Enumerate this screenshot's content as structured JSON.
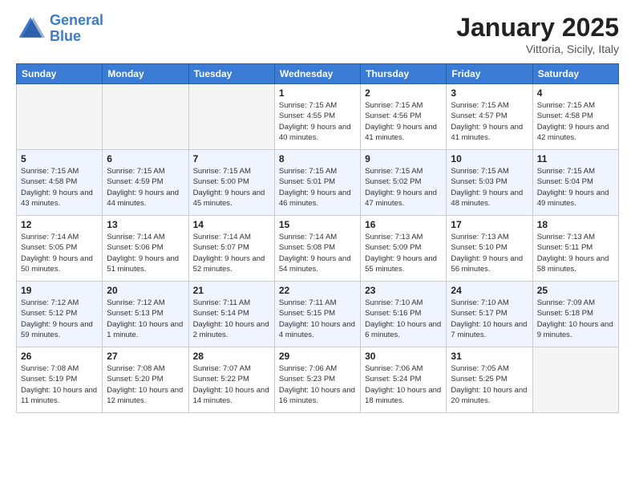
{
  "header": {
    "logo_line1": "General",
    "logo_line2": "Blue",
    "title": "January 2025",
    "subtitle": "Vittoria, Sicily, Italy"
  },
  "weekdays": [
    "Sunday",
    "Monday",
    "Tuesday",
    "Wednesday",
    "Thursday",
    "Friday",
    "Saturday"
  ],
  "weeks": [
    [
      {
        "day": "",
        "info": ""
      },
      {
        "day": "",
        "info": ""
      },
      {
        "day": "",
        "info": ""
      },
      {
        "day": "1",
        "info": "Sunrise: 7:15 AM\nSunset: 4:55 PM\nDaylight: 9 hours\nand 40 minutes."
      },
      {
        "day": "2",
        "info": "Sunrise: 7:15 AM\nSunset: 4:56 PM\nDaylight: 9 hours\nand 41 minutes."
      },
      {
        "day": "3",
        "info": "Sunrise: 7:15 AM\nSunset: 4:57 PM\nDaylight: 9 hours\nand 41 minutes."
      },
      {
        "day": "4",
        "info": "Sunrise: 7:15 AM\nSunset: 4:58 PM\nDaylight: 9 hours\nand 42 minutes."
      }
    ],
    [
      {
        "day": "5",
        "info": "Sunrise: 7:15 AM\nSunset: 4:58 PM\nDaylight: 9 hours\nand 43 minutes."
      },
      {
        "day": "6",
        "info": "Sunrise: 7:15 AM\nSunset: 4:59 PM\nDaylight: 9 hours\nand 44 minutes."
      },
      {
        "day": "7",
        "info": "Sunrise: 7:15 AM\nSunset: 5:00 PM\nDaylight: 9 hours\nand 45 minutes."
      },
      {
        "day": "8",
        "info": "Sunrise: 7:15 AM\nSunset: 5:01 PM\nDaylight: 9 hours\nand 46 minutes."
      },
      {
        "day": "9",
        "info": "Sunrise: 7:15 AM\nSunset: 5:02 PM\nDaylight: 9 hours\nand 47 minutes."
      },
      {
        "day": "10",
        "info": "Sunrise: 7:15 AM\nSunset: 5:03 PM\nDaylight: 9 hours\nand 48 minutes."
      },
      {
        "day": "11",
        "info": "Sunrise: 7:15 AM\nSunset: 5:04 PM\nDaylight: 9 hours\nand 49 minutes."
      }
    ],
    [
      {
        "day": "12",
        "info": "Sunrise: 7:14 AM\nSunset: 5:05 PM\nDaylight: 9 hours\nand 50 minutes."
      },
      {
        "day": "13",
        "info": "Sunrise: 7:14 AM\nSunset: 5:06 PM\nDaylight: 9 hours\nand 51 minutes."
      },
      {
        "day": "14",
        "info": "Sunrise: 7:14 AM\nSunset: 5:07 PM\nDaylight: 9 hours\nand 52 minutes."
      },
      {
        "day": "15",
        "info": "Sunrise: 7:14 AM\nSunset: 5:08 PM\nDaylight: 9 hours\nand 54 minutes."
      },
      {
        "day": "16",
        "info": "Sunrise: 7:13 AM\nSunset: 5:09 PM\nDaylight: 9 hours\nand 55 minutes."
      },
      {
        "day": "17",
        "info": "Sunrise: 7:13 AM\nSunset: 5:10 PM\nDaylight: 9 hours\nand 56 minutes."
      },
      {
        "day": "18",
        "info": "Sunrise: 7:13 AM\nSunset: 5:11 PM\nDaylight: 9 hours\nand 58 minutes."
      }
    ],
    [
      {
        "day": "19",
        "info": "Sunrise: 7:12 AM\nSunset: 5:12 PM\nDaylight: 9 hours\nand 59 minutes."
      },
      {
        "day": "20",
        "info": "Sunrise: 7:12 AM\nSunset: 5:13 PM\nDaylight: 10 hours\nand 1 minute."
      },
      {
        "day": "21",
        "info": "Sunrise: 7:11 AM\nSunset: 5:14 PM\nDaylight: 10 hours\nand 2 minutes."
      },
      {
        "day": "22",
        "info": "Sunrise: 7:11 AM\nSunset: 5:15 PM\nDaylight: 10 hours\nand 4 minutes."
      },
      {
        "day": "23",
        "info": "Sunrise: 7:10 AM\nSunset: 5:16 PM\nDaylight: 10 hours\nand 6 minutes."
      },
      {
        "day": "24",
        "info": "Sunrise: 7:10 AM\nSunset: 5:17 PM\nDaylight: 10 hours\nand 7 minutes."
      },
      {
        "day": "25",
        "info": "Sunrise: 7:09 AM\nSunset: 5:18 PM\nDaylight: 10 hours\nand 9 minutes."
      }
    ],
    [
      {
        "day": "26",
        "info": "Sunrise: 7:08 AM\nSunset: 5:19 PM\nDaylight: 10 hours\nand 11 minutes."
      },
      {
        "day": "27",
        "info": "Sunrise: 7:08 AM\nSunset: 5:20 PM\nDaylight: 10 hours\nand 12 minutes."
      },
      {
        "day": "28",
        "info": "Sunrise: 7:07 AM\nSunset: 5:22 PM\nDaylight: 10 hours\nand 14 minutes."
      },
      {
        "day": "29",
        "info": "Sunrise: 7:06 AM\nSunset: 5:23 PM\nDaylight: 10 hours\nand 16 minutes."
      },
      {
        "day": "30",
        "info": "Sunrise: 7:06 AM\nSunset: 5:24 PM\nDaylight: 10 hours\nand 18 minutes."
      },
      {
        "day": "31",
        "info": "Sunrise: 7:05 AM\nSunset: 5:25 PM\nDaylight: 10 hours\nand 20 minutes."
      },
      {
        "day": "",
        "info": ""
      }
    ]
  ]
}
